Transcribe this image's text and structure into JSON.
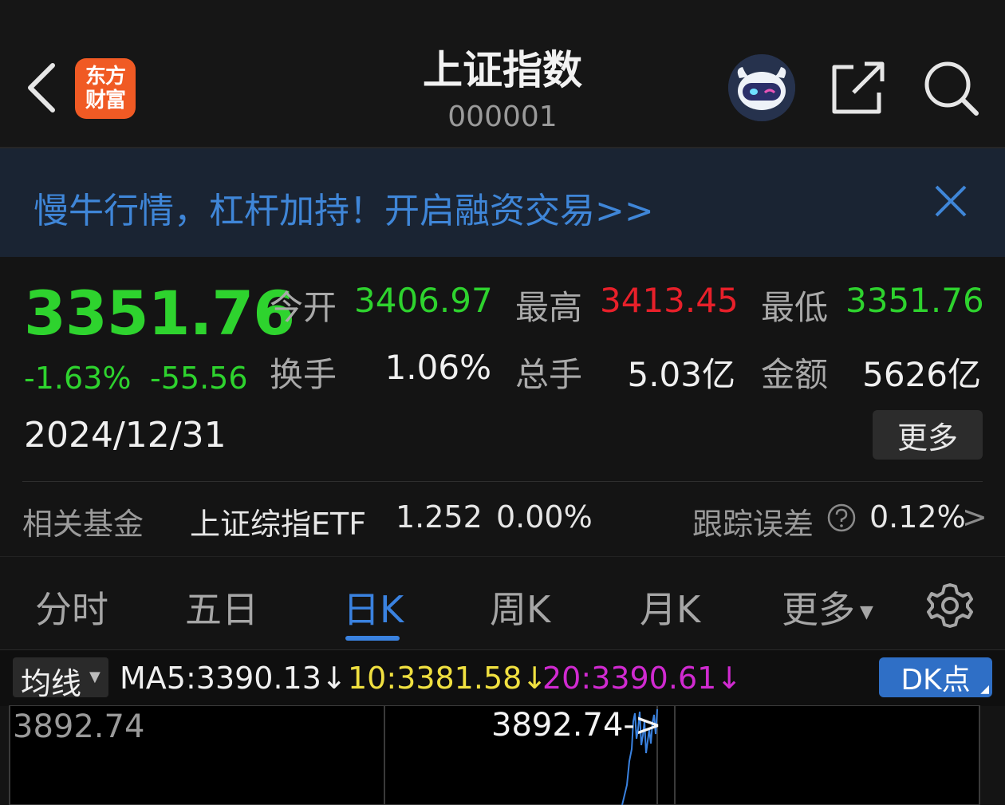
{
  "header": {
    "title": "上证指数",
    "code": "000001",
    "logo_lines": [
      "东方",
      "财富"
    ],
    "icons": [
      "back-arrow-icon",
      "robot-avatar-icon",
      "share-icon",
      "search-icon"
    ]
  },
  "banner": {
    "text": "慢牛行情，杠杆加持！开启融资交易>>",
    "close_icon": "close-icon"
  },
  "quote": {
    "price": "3351.76",
    "change_pct": "-1.63%",
    "change_val": "-55.56",
    "date": "2024/12/31",
    "open_label": "今开",
    "open": "3406.97",
    "high_label": "最高",
    "high": "3413.45",
    "low_label": "最低",
    "low": "3351.76",
    "turnover_label": "换手",
    "turnover": "1.06%",
    "volume_label": "总手",
    "volume": "5.03亿",
    "amount_label": "金额",
    "amount": "5626亿",
    "more_label": "更多"
  },
  "fund": {
    "label": "相关基金",
    "name": "上证综指ETF",
    "price": "1.252",
    "change": "0.00%",
    "track_label": "跟踪误差",
    "track_value": "0.12%",
    "chevron": ">"
  },
  "tabs": [
    {
      "label": "分时",
      "active": false
    },
    {
      "label": "五日",
      "active": false
    },
    {
      "label": "日K",
      "active": true
    },
    {
      "label": "周K",
      "active": false
    },
    {
      "label": "月K",
      "active": false
    },
    {
      "label": "更多",
      "active": false
    }
  ],
  "ma_bar": {
    "select_label": "均线",
    "ma5": "MA5:3390.13↓",
    "ma10": "10:3381.58↓",
    "ma20": "20:3390.61↓",
    "dk_label": "DK点"
  },
  "chart": {
    "max_label": "3892.74",
    "max_annotation": "3892.74->"
  },
  "colors": {
    "down_green": "#2ed32e",
    "up_red": "#e8202a",
    "accent_blue": "#3a82e0",
    "ma10_yellow": "#f0e040",
    "ma20_magenta": "#d02ad0"
  }
}
